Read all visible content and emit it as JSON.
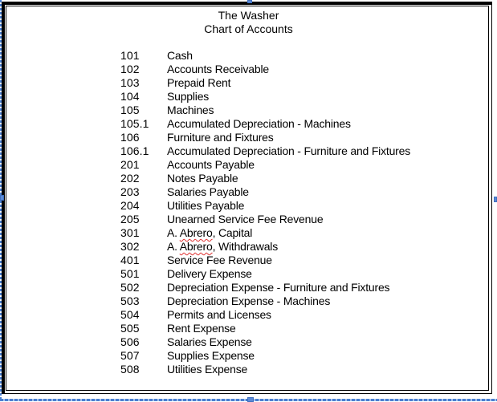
{
  "document": {
    "title": "The Washer",
    "subtitle": "Chart of Accounts",
    "accounts": [
      {
        "code": "101",
        "name": "Cash"
      },
      {
        "code": "102",
        "name": "Accounts Receivable"
      },
      {
        "code": "103",
        "name": "Prepaid Rent"
      },
      {
        "code": "104",
        "name": "Supplies"
      },
      {
        "code": "105",
        "name": "Machines"
      },
      {
        "code": "105.1",
        "name": "Accumulated Depreciation - Machines"
      },
      {
        "code": "106",
        "name": "Furniture and Fixtures"
      },
      {
        "code": "106.1",
        "name": "Accumulated Depreciation - Furniture and Fixtures"
      },
      {
        "code": "201",
        "name": "Accounts Payable"
      },
      {
        "code": "202",
        "name": "Notes Payable"
      },
      {
        "code": "203",
        "name": "Salaries Payable"
      },
      {
        "code": "204",
        "name": "Utilities Payable"
      },
      {
        "code": "205",
        "name": "Unearned Service Fee Revenue"
      },
      {
        "code": "301",
        "name_prefix": "A. ",
        "name_flagged": "Abrero",
        "name_suffix": ", Capital"
      },
      {
        "code": "302",
        "name_prefix": "A. ",
        "name_flagged": "Abrero",
        "name_suffix": ", Withdrawals"
      },
      {
        "code": "401",
        "name": "Service Fee Revenue"
      },
      {
        "code": "501",
        "name": "Delivery Expense"
      },
      {
        "code": "502",
        "name": "Depreciation Expense - Furniture and Fixtures"
      },
      {
        "code": "503",
        "name": "Depreciation Expense - Machines"
      },
      {
        "code": "504",
        "name": "Permits and Licenses"
      },
      {
        "code": "505",
        "name": "Rent Expense"
      },
      {
        "code": "506",
        "name": "Salaries Expense"
      },
      {
        "code": "507",
        "name": "Supplies Expense"
      },
      {
        "code": "508",
        "name": "Utilities Expense"
      }
    ]
  },
  "colors": {
    "selection": "#4a7fd0",
    "spellcheck": "#e03030"
  }
}
